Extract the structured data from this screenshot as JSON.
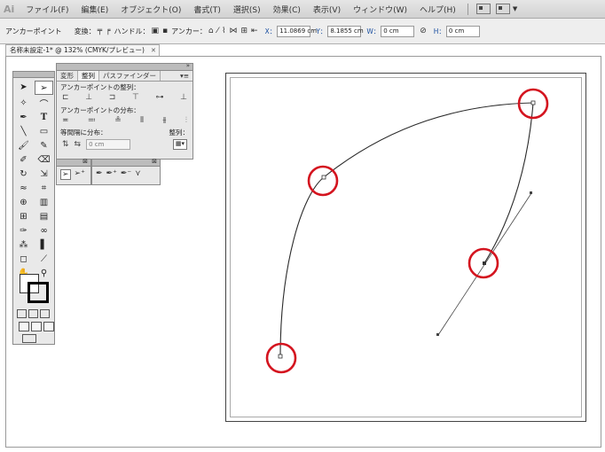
{
  "menubar": {
    "logo": "Ai",
    "items": [
      "ファイル(F)",
      "編集(E)",
      "オブジェクト(O)",
      "書式(T)",
      "選択(S)",
      "効果(C)",
      "表示(V)",
      "ウィンドウ(W)",
      "ヘルプ(H)"
    ]
  },
  "controlbar": {
    "mode_label": "アンカーポイント",
    "convert_label": "変換：",
    "handle_label": "ハンドル：",
    "anchor_label": "アンカー：",
    "x_label": "X：",
    "x_value": "11.0869 cm",
    "y_label": "Y：",
    "y_value": "8.1855 cm",
    "w_label": "W：",
    "w_value": "0 cm",
    "h_label": "H：",
    "h_value": "0 cm"
  },
  "document_tab": {
    "title": "名称未設定-1* @ 132% (CMYK/プレビュー)",
    "close": "✕"
  },
  "align_panel": {
    "tabs": [
      "変形",
      "整列",
      "パスファインダー"
    ],
    "active_tab": "整列",
    "section_align": "アンカーポイントの整列：",
    "section_distribute": "アンカーポイントの分布：",
    "section_spacing": "等間隔に分布：",
    "align_to_label": "整列：",
    "spacing_value": "0 cm"
  },
  "icons": {
    "selection": "selection-icon",
    "direct_selection": "direct-selection-icon",
    "pen": "pen-icon",
    "type": "type-icon"
  },
  "colors": {
    "highlight_circle": "#d4141f",
    "path_stroke": "#2a2a2a"
  }
}
